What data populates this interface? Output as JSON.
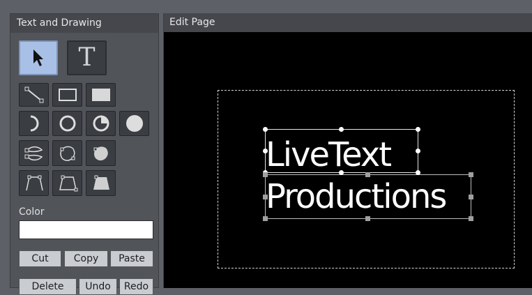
{
  "left_panel": {
    "title": "Text and Drawing",
    "color_label": "Color",
    "tools": [
      {
        "name": "select-tool",
        "icon": "arrow-cursor-icon",
        "active": true
      },
      {
        "name": "text-tool",
        "icon": "text-t-icon",
        "label": "T"
      },
      {
        "name": "line-tool",
        "icon": "line-icon"
      },
      {
        "name": "rectangle-tool",
        "icon": "rectangle-outline-icon"
      },
      {
        "name": "filled-rectangle-tool",
        "icon": "rectangle-filled-icon"
      },
      {
        "name": "arc-tool",
        "icon": "arc-icon"
      },
      {
        "name": "circle-tool",
        "icon": "circle-outline-icon"
      },
      {
        "name": "pie-tool",
        "icon": "pie-icon"
      },
      {
        "name": "filled-circle-tool",
        "icon": "circle-filled-icon"
      },
      {
        "name": "closed-curve-tool",
        "icon": "closed-curve-icon"
      },
      {
        "name": "blob-tool",
        "icon": "blob-outline-icon"
      },
      {
        "name": "filled-blob-tool",
        "icon": "blob-filled-icon"
      },
      {
        "name": "polyline-tool",
        "icon": "polyline-icon"
      },
      {
        "name": "polygon-tool",
        "icon": "polygon-outline-icon"
      },
      {
        "name": "filled-polygon-tool",
        "icon": "polygon-filled-icon"
      }
    ],
    "color_value": "#ffffff",
    "buttons": {
      "cut": "Cut",
      "copy": "Copy",
      "paste": "Paste",
      "delete": "Delete",
      "undo": "Undo",
      "redo": "Redo"
    }
  },
  "right_panel": {
    "title": "Edit Page",
    "text_objects": [
      {
        "text": "LiveText"
      },
      {
        "text": "Productions"
      }
    ]
  },
  "colors": {
    "panel_bg": "#515459",
    "header_bg": "#45474c",
    "active_tool": "#a9c0e6",
    "canvas": "#000000"
  }
}
